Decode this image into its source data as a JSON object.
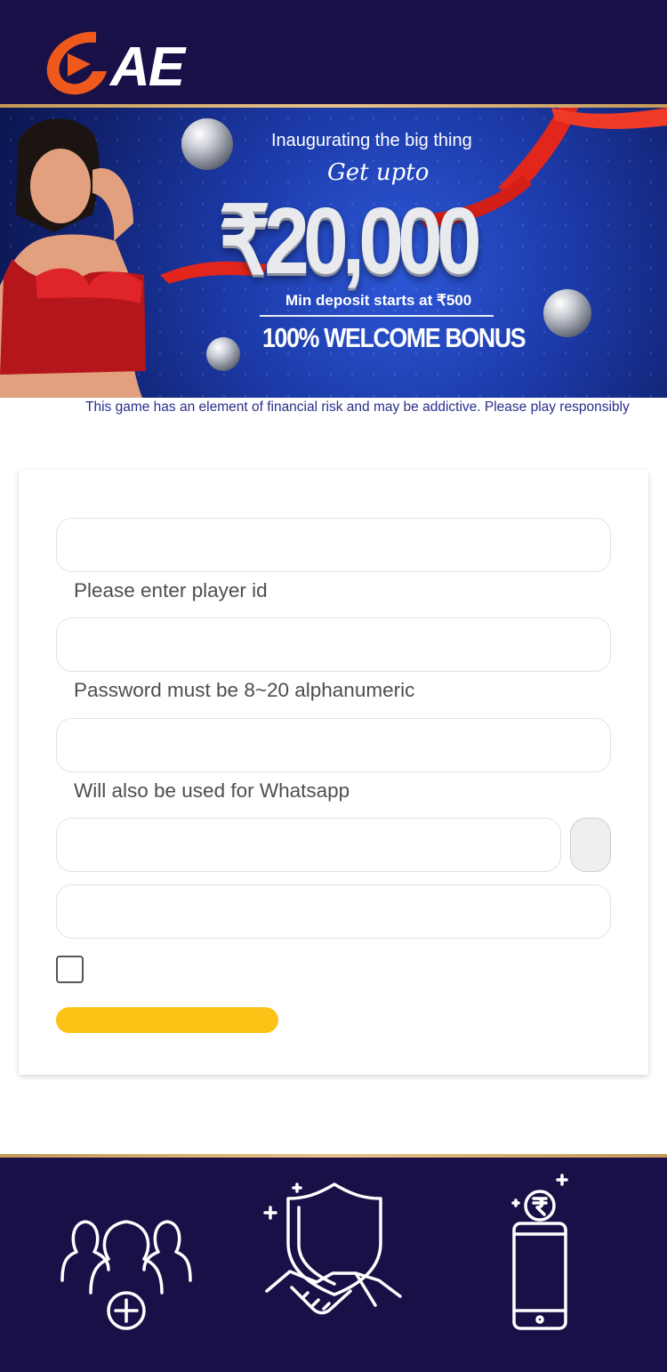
{
  "header": {
    "logo_text": "AE",
    "logo_colors": {
      "accent": "#f0591c",
      "text": "#ffffff"
    },
    "background": "#1a1048"
  },
  "banner": {
    "title": "Inaugurating the big thing",
    "script_text": "Get upto",
    "amount": "₹20,000",
    "min_deposit": "Min deposit starts at ₹500",
    "bonus": "100% WELCOME BONUS"
  },
  "ticker": {
    "text": "This game has an element of financial risk and may be addictive. Please play responsibly"
  },
  "form": {
    "fields": [
      {
        "name": "player-id",
        "value": "",
        "hint": "Please enter player id"
      },
      {
        "name": "password",
        "value": "",
        "hint": "Password must be 8~20 alphanumeric"
      },
      {
        "name": "phone",
        "value": "",
        "hint": "Will also be used for Whatsapp"
      },
      {
        "name": "otp",
        "value": ""
      },
      {
        "name": "extra",
        "value": ""
      }
    ],
    "checkbox_checked": false,
    "submit_label": "",
    "submit_color": "#fcc216"
  },
  "footer": {
    "icons": [
      "add-users-icon",
      "secure-handshake-icon",
      "mobile-rupee-icon"
    ],
    "background": "#1a1048"
  }
}
